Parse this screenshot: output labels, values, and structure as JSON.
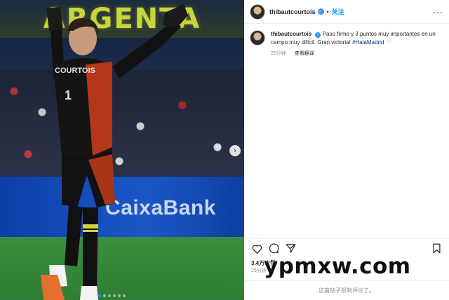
{
  "photo": {
    "banner_text": "ARGENTA",
    "adboard_text": "CaixaBank",
    "jersey_name": "COURTOIS",
    "jersey_number": "1",
    "carousel_next_icon": "chevron-right-icon",
    "carousel_dots": 6,
    "carousel_active_index": 0
  },
  "header": {
    "username": "thibautcourtois",
    "verified_icon": "verified-badge-icon",
    "separator": "•",
    "follow_label": "关注",
    "more_icon": "more-horizontal-icon"
  },
  "caption": {
    "username": "thibautcourtois",
    "text": "Paso firme y 3 puntos muy importantes en un campo muy difícil. Gran victoria! ",
    "hashtag": "#HalaMadrid",
    "time_ago": "25分钟",
    "translate_label": "查看翻译"
  },
  "actions": {
    "like_icon": "heart-icon",
    "comment_icon": "comment-icon",
    "share_icon": "send-icon",
    "save_icon": "bookmark-icon"
  },
  "stats": {
    "likes": "3.4万次赞",
    "date": "25分钟"
  },
  "comments": {
    "disabled_text": "这篇帖子限制评论了。"
  },
  "watermark": {
    "text": "ypmxw.com"
  },
  "colors": {
    "link_blue": "#0095f6",
    "verified_blue": "#3897f0",
    "hashtag": "#00376b",
    "banner_yellow": "#c9d63a",
    "adboard_blue": "#1a57c7"
  }
}
